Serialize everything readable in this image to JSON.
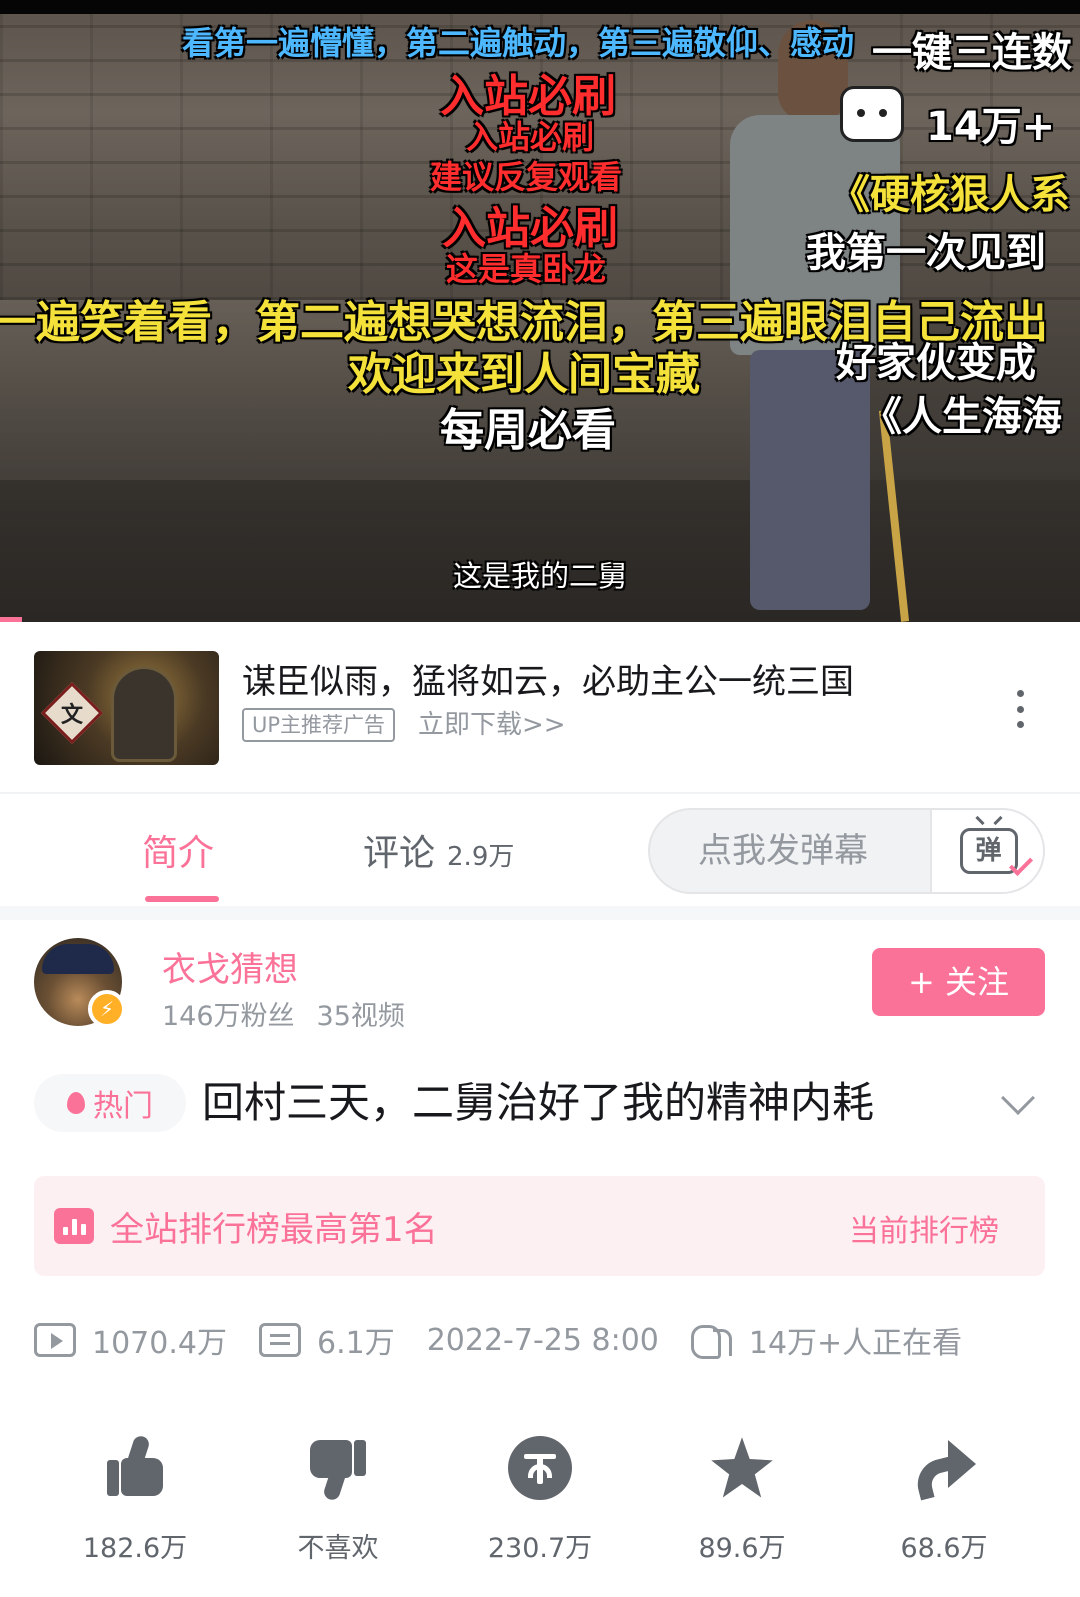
{
  "player": {
    "danmaku": [
      "看第一遍懵懂，第二遍触动，第三遍敬仰、感动",
      "一键三连数",
      "入站必刷",
      "14万+",
      "入站必刷",
      "《硬核狠人系",
      "建议反复观看",
      "入站必刷",
      "我第一次见到",
      "这是真卧龙",
      "一遍笑着看，第二遍想哭想流泪，第三遍眼泪自己流出",
      "好家伙变成",
      "欢迎来到人间宝藏",
      "《人生海海",
      "每周必看"
    ],
    "subtitle": "这是我的二舅",
    "progress_fraction": 0.02
  },
  "ad": {
    "title": "谋臣似雨，猛将如云，必助主公一统三国",
    "tag": "UP主推荐广告",
    "link": "立即下载>>",
    "thumb_glyph": "文"
  },
  "tabs": {
    "intro": "简介",
    "comments": "评论",
    "comments_count": "2.9万",
    "danmaku_placeholder": "点我发弹幕",
    "danmaku_button": "弹"
  },
  "uploader": {
    "name": "衣戈猜想",
    "fans": "146万粉丝",
    "videos": "35视频",
    "follow": "+ 关注"
  },
  "video": {
    "hot_tag": "热门",
    "title": "回村三天，二舅治好了我的精神内耗"
  },
  "ranking": {
    "text": "全站排行榜最高第1名",
    "link": "当前排行榜"
  },
  "meta": {
    "plays": "1070.4万",
    "danmaku": "6.1万",
    "date": "2022-7-25 8:00",
    "watching": "14万+人正在看"
  },
  "actions": {
    "like": "182.6万",
    "dislike": "不喜欢",
    "coin": "230.7万",
    "favorite": "89.6万",
    "share": "68.6万"
  },
  "colors": {
    "accent": "#fb7299",
    "text": "#18191c",
    "secondary": "#9499a0",
    "icon": "#61666d"
  }
}
